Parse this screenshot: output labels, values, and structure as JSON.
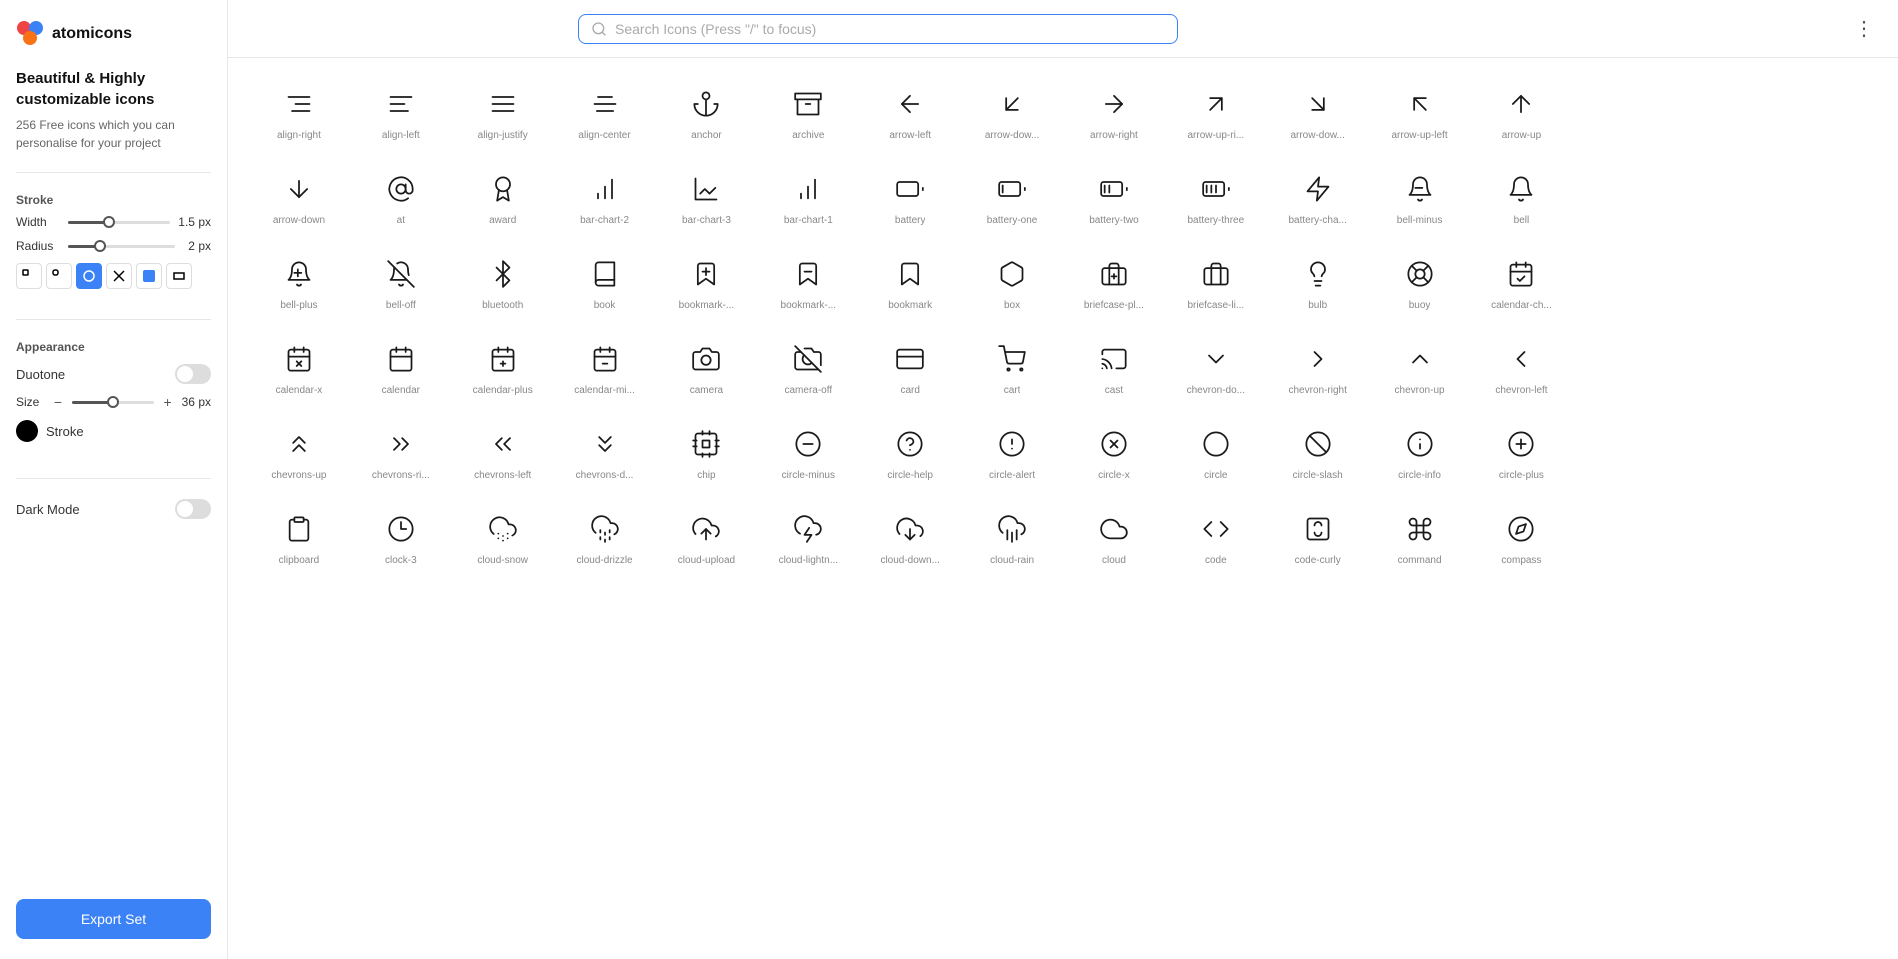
{
  "app": {
    "name": "atomicons"
  },
  "sidebar": {
    "tagline": "Beautiful & Highly customizable icons",
    "subtitle": "256 Free icons which you can personalise for your project",
    "stroke": {
      "label": "Stroke",
      "width_label": "Width",
      "width_value": "1.5",
      "width_unit": "px",
      "width_percent": 40,
      "radius_label": "Radius",
      "radius_value": "2",
      "radius_unit": "px",
      "radius_percent": 30
    },
    "appearance": {
      "label": "Appearance",
      "duotone_label": "Duotone",
      "duotone_on": false,
      "size_label": "Size",
      "size_value": "36",
      "size_unit": "px",
      "stroke_label": "Stroke",
      "dark_mode_label": "Dark Mode",
      "dark_mode_on": false
    },
    "export_label": "Export Set"
  },
  "search": {
    "placeholder": "Search Icons (Press \"/\" to focus)"
  },
  "icons": [
    [
      {
        "name": "align-right",
        "glyph": "≡"
      },
      {
        "name": "align-left",
        "glyph": "≡"
      },
      {
        "name": "align-justify",
        "glyph": "≡"
      },
      {
        "name": "align-center",
        "glyph": "≡"
      },
      {
        "name": "anchor",
        "glyph": "⚓"
      },
      {
        "name": "archive",
        "glyph": "▭"
      },
      {
        "name": "arrow-left",
        "glyph": "←"
      },
      {
        "name": "arrow-dow...",
        "glyph": "↙"
      },
      {
        "name": "arrow-right",
        "glyph": "→"
      },
      {
        "name": "arrow-up-ri...",
        "glyph": "↗"
      },
      {
        "name": "arrow-dow...",
        "glyph": "↘"
      },
      {
        "name": "arrow-up-left",
        "glyph": "↖"
      },
      {
        "name": "arrow-up",
        "glyph": "↑"
      },
      {
        "name": "",
        "glyph": ""
      },
      {
        "name": "",
        "glyph": ""
      },
      {
        "name": "",
        "glyph": ""
      }
    ],
    [
      {
        "name": "arrow-down",
        "glyph": "↓"
      },
      {
        "name": "at",
        "glyph": "@"
      },
      {
        "name": "award",
        "glyph": "🏅"
      },
      {
        "name": "bar-chart-2",
        "glyph": "📊"
      },
      {
        "name": "bar-chart-3",
        "glyph": "📊"
      },
      {
        "name": "bar-chart-1",
        "glyph": "📊"
      },
      {
        "name": "battery",
        "glyph": "🔋"
      },
      {
        "name": "battery-one",
        "glyph": "🔋"
      },
      {
        "name": "battery-two",
        "glyph": "🔋"
      },
      {
        "name": "battery-three",
        "glyph": "🔋"
      },
      {
        "name": "battery-cha...",
        "glyph": "⚡"
      },
      {
        "name": "bell-minus",
        "glyph": "🔔"
      },
      {
        "name": "bell",
        "glyph": "🔔"
      },
      {
        "name": "",
        "glyph": ""
      },
      {
        "name": "",
        "glyph": ""
      },
      {
        "name": "",
        "glyph": ""
      }
    ],
    [
      {
        "name": "bell-plus",
        "glyph": "🔔"
      },
      {
        "name": "bell-off",
        "glyph": "🔕"
      },
      {
        "name": "bluetooth",
        "glyph": "₿"
      },
      {
        "name": "book",
        "glyph": "📖"
      },
      {
        "name": "bookmark-...",
        "glyph": "🔖"
      },
      {
        "name": "bookmark-...",
        "glyph": "🔖"
      },
      {
        "name": "bookmark",
        "glyph": "🔖"
      },
      {
        "name": "box",
        "glyph": "📦"
      },
      {
        "name": "briefcase-pl...",
        "glyph": "💼"
      },
      {
        "name": "briefcase-li...",
        "glyph": "💼"
      },
      {
        "name": "bulb",
        "glyph": "💡"
      },
      {
        "name": "buoy",
        "glyph": "🆘"
      },
      {
        "name": "calendar-ch...",
        "glyph": "📅"
      },
      {
        "name": "",
        "glyph": ""
      },
      {
        "name": "",
        "glyph": ""
      },
      {
        "name": "",
        "glyph": ""
      }
    ],
    [
      {
        "name": "calendar-x",
        "glyph": "📅"
      },
      {
        "name": "calendar",
        "glyph": "📅"
      },
      {
        "name": "calendar-plus",
        "glyph": "📅"
      },
      {
        "name": "calendar-mi...",
        "glyph": "📅"
      },
      {
        "name": "camera",
        "glyph": "📷"
      },
      {
        "name": "camera-off",
        "glyph": "📷"
      },
      {
        "name": "card",
        "glyph": "💳"
      },
      {
        "name": "cart",
        "glyph": "🛒"
      },
      {
        "name": "cast",
        "glyph": "📺"
      },
      {
        "name": "chevron-do...",
        "glyph": "∨"
      },
      {
        "name": "chevron-right",
        "glyph": "›"
      },
      {
        "name": "chevron-up",
        "glyph": "∧"
      },
      {
        "name": "chevron-left",
        "glyph": "‹"
      },
      {
        "name": "",
        "glyph": ""
      },
      {
        "name": "",
        "glyph": ""
      },
      {
        "name": "",
        "glyph": ""
      }
    ],
    [
      {
        "name": "chevrons-up",
        "glyph": "⋀"
      },
      {
        "name": "chevrons-ri...",
        "glyph": "»"
      },
      {
        "name": "chevrons-left",
        "glyph": "«"
      },
      {
        "name": "chevrons-d...",
        "glyph": "⋁"
      },
      {
        "name": "chip",
        "glyph": "⬜"
      },
      {
        "name": "circle-minus",
        "glyph": "⊖"
      },
      {
        "name": "circle-help",
        "glyph": "?"
      },
      {
        "name": "circle-alert",
        "glyph": "!"
      },
      {
        "name": "circle-x",
        "glyph": "✕"
      },
      {
        "name": "circle",
        "glyph": "○"
      },
      {
        "name": "circle-slash",
        "glyph": "⊘"
      },
      {
        "name": "circle-info",
        "glyph": "ℹ"
      },
      {
        "name": "circle-plus",
        "glyph": "⊕"
      },
      {
        "name": "",
        "glyph": ""
      },
      {
        "name": "",
        "glyph": ""
      },
      {
        "name": "",
        "glyph": ""
      }
    ],
    [
      {
        "name": "clipboard",
        "glyph": "📋"
      },
      {
        "name": "clock-3",
        "glyph": "🕒"
      },
      {
        "name": "cloud-snow",
        "glyph": "🌨"
      },
      {
        "name": "cloud-drizzle",
        "glyph": "🌦"
      },
      {
        "name": "cloud-upload",
        "glyph": "☁"
      },
      {
        "name": "cloud-lightn...",
        "glyph": "⚡"
      },
      {
        "name": "cloud-down...",
        "glyph": "☁"
      },
      {
        "name": "cloud-rain",
        "glyph": "🌧"
      },
      {
        "name": "cloud",
        "glyph": "☁"
      },
      {
        "name": "code",
        "glyph": "<>"
      },
      {
        "name": "code-curly",
        "glyph": "{}"
      },
      {
        "name": "command",
        "glyph": "⌘"
      },
      {
        "name": "compass",
        "glyph": "🧭"
      },
      {
        "name": "",
        "glyph": ""
      },
      {
        "name": "",
        "glyph": ""
      },
      {
        "name": "",
        "glyph": ""
      }
    ]
  ]
}
